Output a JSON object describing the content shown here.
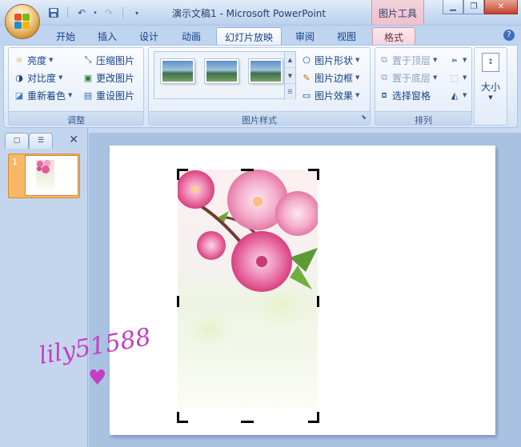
{
  "window": {
    "title": "演示文稿1 - Microsoft PowerPoint",
    "context_tab": "图片工具",
    "buttons": [
      "minimize",
      "restore",
      "close"
    ]
  },
  "quick_access": [
    "save-icon",
    "undo-icon",
    "redo-icon",
    "customize-icon"
  ],
  "tabs": [
    {
      "label": "开始"
    },
    {
      "label": "插入"
    },
    {
      "label": "设计"
    },
    {
      "label": "动画"
    },
    {
      "label": "幻灯片放映"
    },
    {
      "label": "审阅"
    },
    {
      "label": "视图"
    },
    {
      "label": "格式"
    }
  ],
  "ribbon": {
    "adjust": {
      "label": "调整",
      "brightness": "亮度",
      "contrast": "对比度",
      "recolor": "重新着色",
      "compress": "压缩图片",
      "change": "更改图片",
      "reset": "重设图片"
    },
    "styles": {
      "label": "图片样式",
      "shape": "图片形状",
      "border": "图片边框",
      "effects": "图片效果"
    },
    "arrange": {
      "label": "排列",
      "bring_front": "置于顶层",
      "send_back": "置于底层",
      "selection_pane": "选择窗格"
    },
    "size": {
      "label": "大小"
    }
  },
  "slide_panel": {
    "slide_number": "1"
  },
  "watermark": "lily51588",
  "colors": {
    "accent": "#15428b",
    "context_tab": "#f0c8d3",
    "selected_slide": "#f7b766",
    "watermark": "#c43ec4"
  }
}
